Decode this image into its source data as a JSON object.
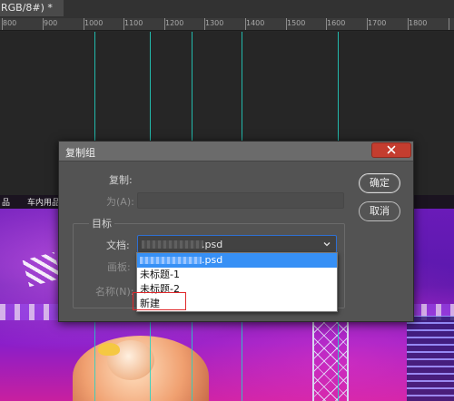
{
  "document_tab": {
    "title": "RGB/8#) *"
  },
  "ruler": {
    "labels": [
      "800",
      "900",
      "1000",
      "1100",
      "1200",
      "1300",
      "1400",
      "1500",
      "1600",
      "1700",
      "1800"
    ]
  },
  "background_nav": {
    "items": [
      "品",
      "车内用品"
    ]
  },
  "dialog": {
    "title": "复制组",
    "copy_label": "复制:",
    "as_label": "为(A):",
    "as_value": "",
    "target_group_label": "目标",
    "document_label": "文档:",
    "document_value": ".psd",
    "artboard_label": "画板:",
    "name_label": "名称(N):",
    "ok_button": "确定",
    "cancel_button": "取消",
    "close_icon": "close-icon",
    "dropdown_options": [
      {
        "label": ".psd",
        "selected": true
      },
      {
        "label": "未标题-1",
        "selected": false
      },
      {
        "label": "未标题-2",
        "selected": false
      },
      {
        "label": "新建",
        "selected": false,
        "highlighted": true
      }
    ]
  },
  "colors": {
    "guide": "#22d3c4",
    "close_button": "#c43d2f",
    "selection": "#3790f5",
    "highlight_box": "#e0292c",
    "dialog_bg": "#535353"
  }
}
